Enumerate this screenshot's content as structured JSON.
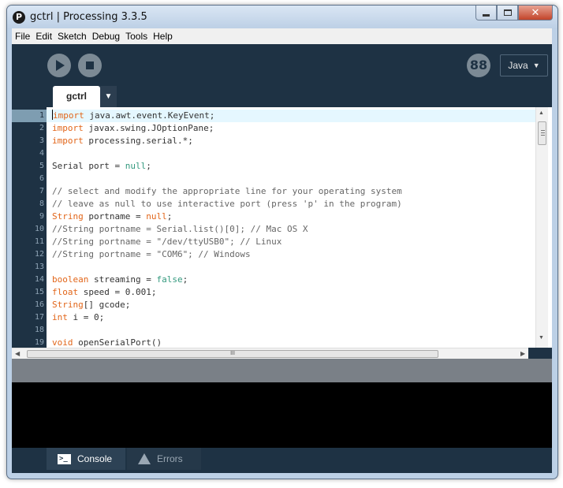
{
  "window": {
    "title": "gctrl | Processing 3.3.5",
    "app_icon_glyph": "P",
    "close_glyph": "✕"
  },
  "menu": [
    "File",
    "Edit",
    "Sketch",
    "Debug",
    "Tools",
    "Help"
  ],
  "toolbar": {
    "mode_icon_glyph": "88",
    "mode_label": "Java",
    "mode_arrow": "▼"
  },
  "tabs": {
    "active": "gctrl",
    "menu_arrow": "▼"
  },
  "editor": {
    "current_line": 1,
    "lines": [
      {
        "num": "1",
        "segs": [
          {
            "t": "import",
            "c": "kw"
          },
          {
            "t": " java.awt.event.KeyEvent;"
          }
        ]
      },
      {
        "num": "2",
        "segs": [
          {
            "t": "import",
            "c": "kw"
          },
          {
            "t": " javax.swing.JOptionPane;"
          }
        ]
      },
      {
        "num": "3",
        "segs": [
          {
            "t": "import",
            "c": "kw"
          },
          {
            "t": " processing.serial.*;"
          }
        ]
      },
      {
        "num": "4",
        "segs": []
      },
      {
        "num": "5",
        "segs": [
          {
            "t": "Serial port = "
          },
          {
            "t": "null",
            "c": "lit"
          },
          {
            "t": ";"
          }
        ]
      },
      {
        "num": "6",
        "segs": []
      },
      {
        "num": "7",
        "segs": [
          {
            "t": "// select and modify the appropriate line for your operating system",
            "c": "cm"
          }
        ]
      },
      {
        "num": "8",
        "segs": [
          {
            "t": "// leave as null to use interactive port (press 'p' in the program)",
            "c": "cm"
          }
        ]
      },
      {
        "num": "9",
        "segs": [
          {
            "t": "String",
            "c": "kw"
          },
          {
            "t": " portname = "
          },
          {
            "t": "null",
            "c": "kw"
          },
          {
            "t": ";"
          }
        ]
      },
      {
        "num": "10",
        "segs": [
          {
            "t": "//String portname = Serial.list()[0]; // Mac OS X",
            "c": "cm"
          }
        ]
      },
      {
        "num": "11",
        "segs": [
          {
            "t": "//String portname = \"/dev/ttyUSB0\"; // Linux",
            "c": "cm"
          }
        ]
      },
      {
        "num": "12",
        "segs": [
          {
            "t": "//String portname = \"COM6\"; // Windows",
            "c": "cm"
          }
        ]
      },
      {
        "num": "13",
        "segs": []
      },
      {
        "num": "14",
        "segs": [
          {
            "t": "boolean",
            "c": "kw"
          },
          {
            "t": " streaming = "
          },
          {
            "t": "false",
            "c": "lit"
          },
          {
            "t": ";"
          }
        ]
      },
      {
        "num": "15",
        "segs": [
          {
            "t": "float",
            "c": "kw"
          },
          {
            "t": " speed = 0.001;"
          }
        ]
      },
      {
        "num": "16",
        "segs": [
          {
            "t": "String",
            "c": "kw"
          },
          {
            "t": "[] gcode;"
          }
        ]
      },
      {
        "num": "17",
        "segs": [
          {
            "t": "int",
            "c": "kw"
          },
          {
            "t": " i = 0;"
          }
        ]
      },
      {
        "num": "18",
        "segs": []
      },
      {
        "num": "19",
        "segs": [
          {
            "t": "void",
            "c": "kw"
          },
          {
            "t": " openSerialPort()"
          }
        ]
      }
    ]
  },
  "scroll": {
    "up": "▲",
    "down": "▼",
    "left": "◀",
    "right": "▶",
    "grip": "III"
  },
  "footer": {
    "console_label": "Console",
    "console_icon_glyph": ">_",
    "errors_label": "Errors"
  },
  "colors": {
    "keyword": "#e2661a",
    "literal": "#33997e",
    "comment": "#666666",
    "chrome": "#1e3244"
  }
}
